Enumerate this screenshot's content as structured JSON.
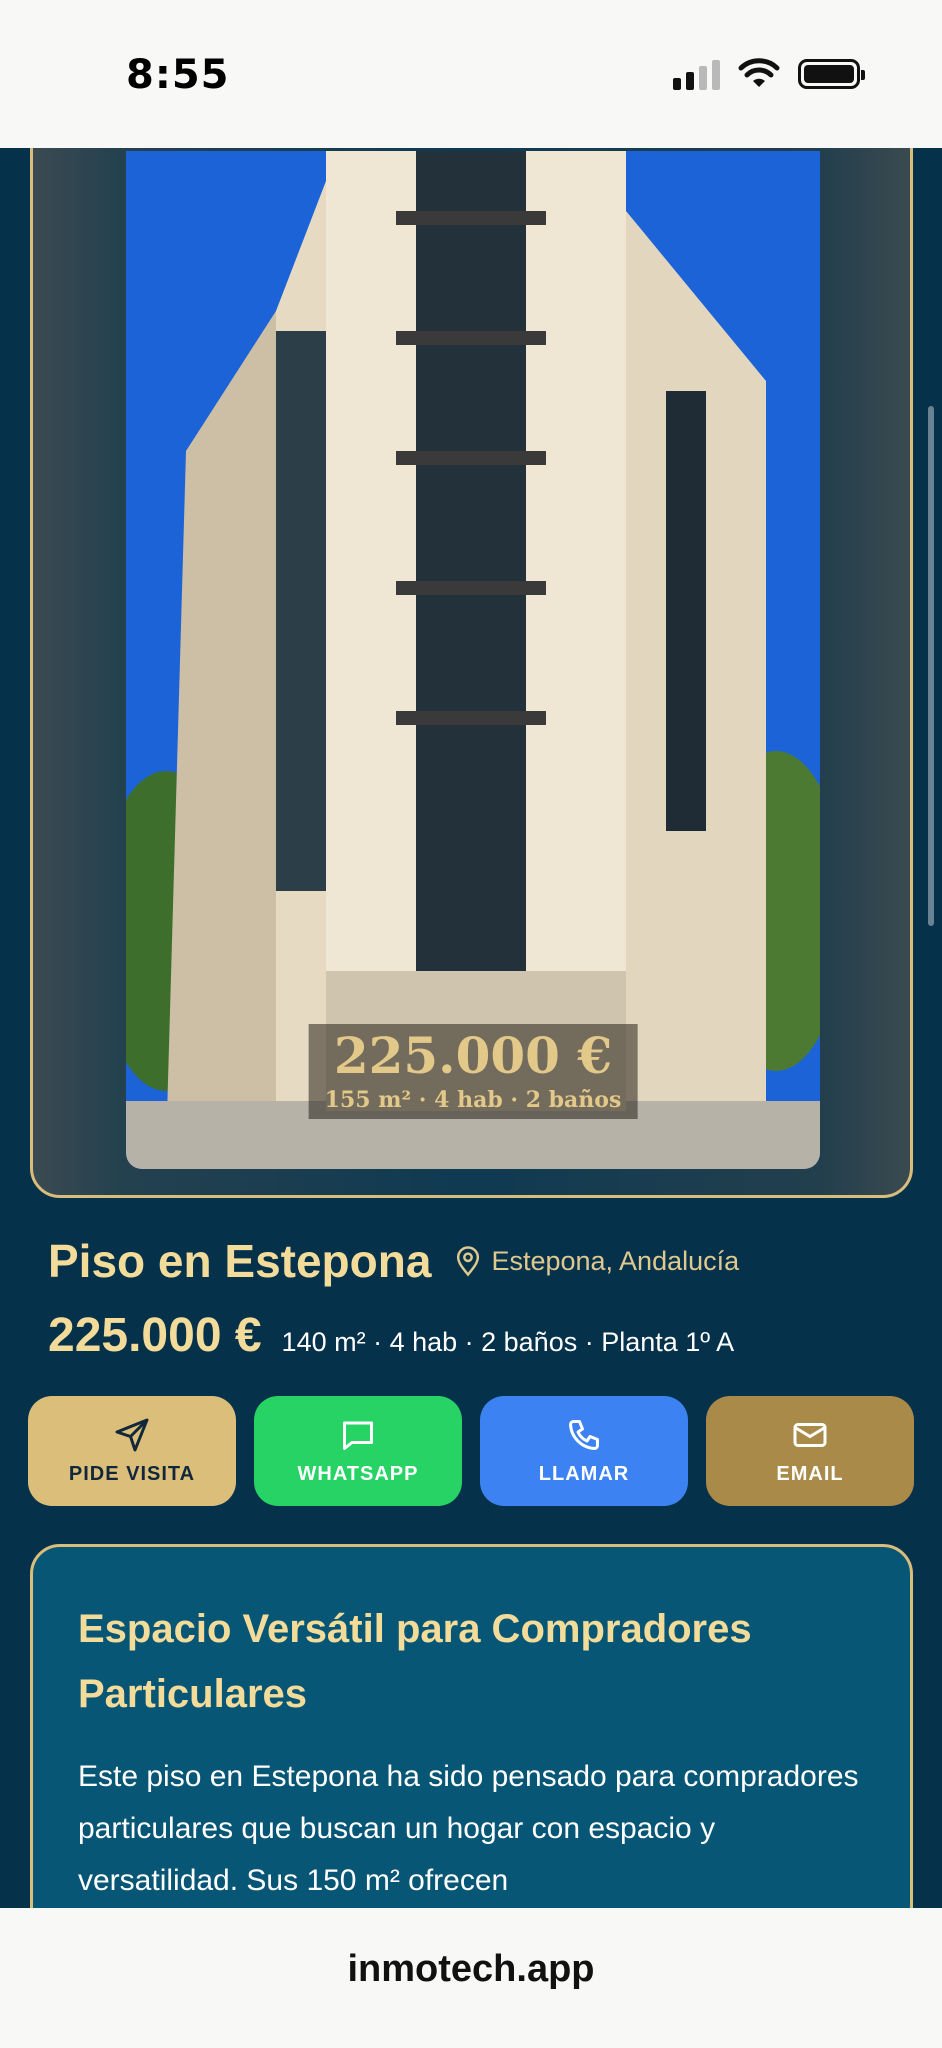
{
  "status": {
    "time": "8:55"
  },
  "hero": {
    "price": "225.000 €",
    "specs": "155 m² · 4 hab · 2 baños"
  },
  "listing": {
    "title": "Piso en Estepona",
    "location": "Estepona, Andalucía",
    "price": "225.000 €",
    "specs": "140 m² · 4 hab · 2 baños · Planta 1º A"
  },
  "actions": [
    {
      "label": "PIDE VISITA",
      "icon": "send-icon"
    },
    {
      "label": "WHATSAPP",
      "icon": "chat-icon"
    },
    {
      "label": "LLAMAR",
      "icon": "phone-icon"
    },
    {
      "label": "EMAIL",
      "icon": "mail-icon"
    }
  ],
  "description": {
    "title": "Espacio Versátil para Compradores Particulares",
    "body": "Este piso en Estepona ha sido pensado para compradores particulares que buscan un hogar con espacio y versatilidad. Sus 150 m² ofrecen"
  },
  "browser": {
    "url": "inmotech.app"
  },
  "colors": {
    "background": "#05314a",
    "gold": "#f3dc9a",
    "whatsapp": "#27d365",
    "call": "#3c82f2",
    "email": "#aa8a48"
  }
}
